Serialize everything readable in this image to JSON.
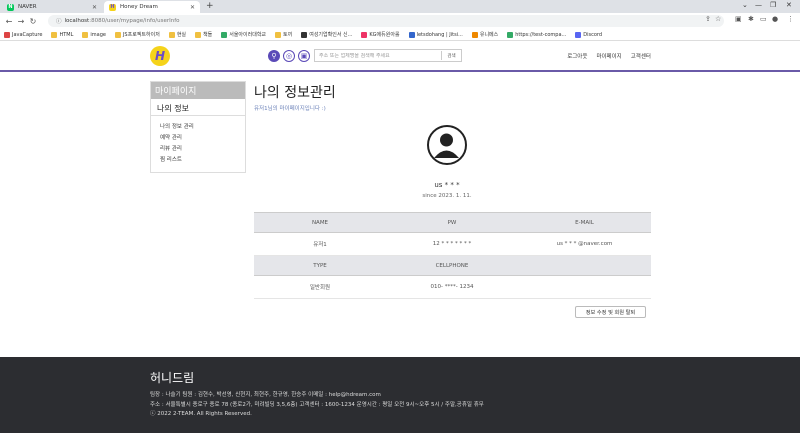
{
  "browser": {
    "tabs": [
      {
        "label": "NAVER",
        "active": false
      },
      {
        "label": "Honey Dream",
        "active": true
      }
    ],
    "url_host": "localhost",
    "url_path": ":8080/user/mypage/info/userInfo",
    "bookmarks": [
      "JavaCapture",
      "HTML",
      "image",
      "JS프로젝트하이저",
      "현실",
      "책들",
      "서울아이러대학교",
      "토끼",
      "여성기업확인서 신...",
      "KG에듀원아롤",
      "letsdohang | Jitsi...",
      "유니메스",
      "https://test-compa...",
      "Discord"
    ]
  },
  "header": {
    "logo_letter": "H",
    "search_placeholder": "주소 또는 업체명을 검색해 주세요",
    "search_button": "검색",
    "nav": [
      "로그아웃",
      "마이페이지",
      "고객센터"
    ]
  },
  "sidebar": {
    "title": "마이페이지",
    "section": "나의 정보",
    "items": [
      "나의 정보 관리",
      "예약 관리",
      "리뷰 관리",
      "찜 리스트"
    ]
  },
  "main": {
    "title": "나의 정보관리",
    "subtitle": "유저1님의 마이페이지입니다 :)",
    "username": "us * * *",
    "since": "since 2023. 1. 11.",
    "table1": {
      "headers": [
        "NAME",
        "PW",
        "E-MAIL"
      ],
      "values": [
        "유저1",
        "12 * * * * * * *",
        "us * * * @naver.com"
      ]
    },
    "table2": {
      "headers": [
        "TYPE",
        "CELLPHONE",
        ""
      ],
      "values": [
        "일반회원",
        "010- ****- 1234",
        ""
      ]
    },
    "edit_button": "정보 수정 및 회원 탈퇴"
  },
  "footer": {
    "title": "허니드림",
    "line1": "팀장 : 나슬기     팀원 : 김현수, 박선영, 신현지, 최현주, 한규영, 한승주     이메일 : help@hdream.com",
    "line2": "주소 : 서울특별시 종로구 종로 78 (종로2가, 미려빌딩 3,5,6층)     고객센터 : 1600-1234     운영시간 : 평일 오전 9시~오후 5시 / 주말,공휴일 휴무",
    "line3": "ⓒ 2022 2-TEAM. All Rights Reserved."
  },
  "colors": {
    "accent": "#6a5aa8",
    "logo_yellow": "#f5d31a",
    "footer_bg": "#2c2d31"
  }
}
